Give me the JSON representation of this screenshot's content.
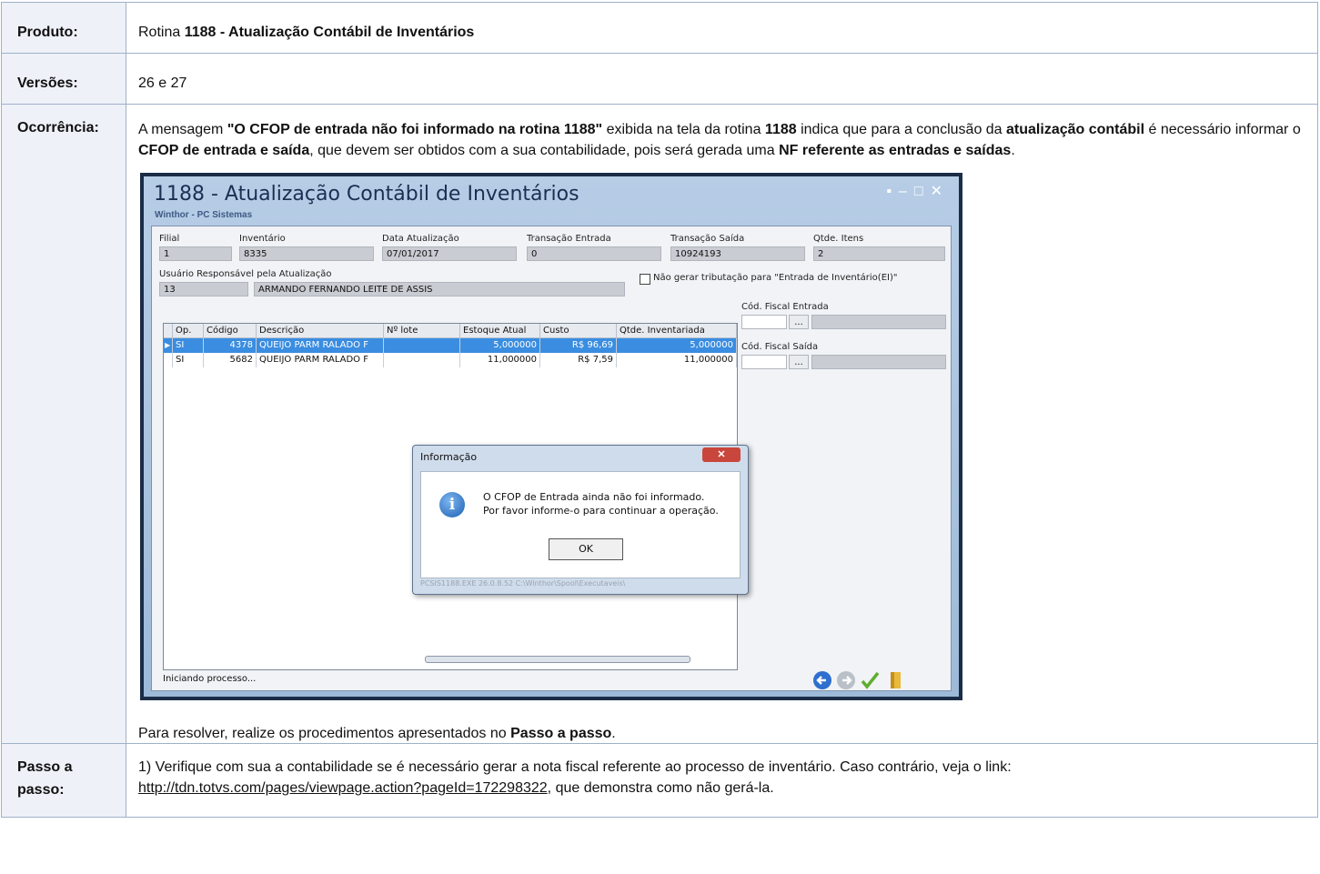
{
  "doc": {
    "produto_label": "Produto:",
    "produto_pre": "Rotina ",
    "produto_bold": "1188 - Atualização Contábil de Inventários",
    "versoes_label": "Versões:",
    "versoes_value": "26 e 27",
    "ocorrencia_label": "Ocorrência:",
    "occ": {
      "t1": "A mensagem ",
      "b1": "\"O CFOP de entrada não foi informado na rotina 1188\"",
      "t2": " exibida na tela da rotina ",
      "b2": "1188",
      "t3": " indica que para a conclusão da ",
      "b3": "atualização contábil",
      "t4": " é necessário informar o ",
      "b4": "CFOP de entrada e saída",
      "t5": ", que devem ser obtidos com a sua contabilidade, pois será gerada uma ",
      "b5": "NF referente as entradas e saídas",
      "t6": "."
    },
    "resolve_pre": "Para resolver, realize os procedimentos apresentados no ",
    "resolve_bold": "Passo a passo",
    "resolve_post": ".",
    "passo_label_1": "Passo a",
    "passo_label_2": "passo:",
    "passo_text": "1) Verifique com sua a contabilidade se é necessário gerar a nota fiscal referente ao processo de inventário. Caso contrário, veja o link:",
    "passo_link": "http://tdn.totvs.com/pages/viewpage.action?pageId=172298322",
    "passo_post": ", que demonstra como não gerá-la."
  },
  "app": {
    "title": "1188 - Atualização Contábil de Inventários",
    "subtitle": "Winthor - PC Sistemas",
    "fields": {
      "filial_label": "Filial",
      "filial": "1",
      "inventario_label": "Inventário",
      "inventario": "8335",
      "data_label": "Data Atualização",
      "data": "07/01/2017",
      "trans_ent_label": "Transação Entrada",
      "trans_ent": "0",
      "trans_sai_label": "Transação Saída",
      "trans_sai": "10924193",
      "qtde_label": "Qtde. Itens",
      "qtde": "2",
      "usuario_label": "Usuário Responsável pela Atualização",
      "usuario_cod": "13",
      "usuario_nome": "ARMANDO FERNANDO LEITE DE ASSIS",
      "nao_gerar_label": "Não gerar tributação para \"Entrada de Inventário(EI)\"",
      "cod_ent_label": "Cód. Fiscal Entrada",
      "cod_sai_label": "Cód. Fiscal Saída",
      "ellipsis": "..."
    },
    "grid": {
      "headers": [
        "Op.",
        "Código",
        "Descrição",
        "Nº lote",
        "Estoque Atual",
        "Custo",
        "Qtde. Inventariada"
      ],
      "rows": [
        [
          "SI",
          "4378",
          "QUEIJO PARM RALADO F",
          "",
          "5,000000",
          "R$ 96,69",
          "5,000000"
        ],
        [
          "SI",
          "5682",
          "QUEIJO PARM RALADO F",
          "",
          "11,000000",
          "R$ 7,59",
          "11,000000"
        ]
      ]
    },
    "dialog": {
      "title": "Informação",
      "line1": "O CFOP de Entrada ainda não foi informado.",
      "line2": "Por favor informe-o para continuar a operação.",
      "ok": "OK",
      "footer": "PCSIS1188.EXE 26.0.8.52 C:\\Winthor\\Spool\\Executaveis\\"
    },
    "status": "Iniciando processo...",
    "colors": {
      "selected_row": "#3a8de0",
      "title_text": "#1a2f52"
    }
  }
}
